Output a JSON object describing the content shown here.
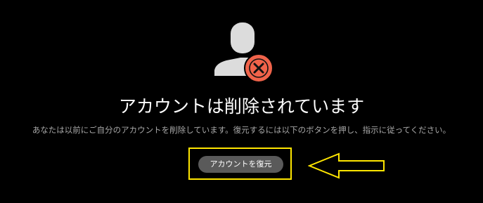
{
  "icons": {
    "avatar": "user-deleted-icon",
    "badge": "close-icon",
    "pointer": "arrow-left-icon"
  },
  "colors": {
    "background": "#000000",
    "avatar": "#dcdcdc",
    "badge": "#f0634a",
    "highlight": "#ffe600",
    "button": "#5a5a5a"
  },
  "main": {
    "title": "アカウントは削除されています",
    "description": "あなたは以前にご自分のアカウントを削除しています。復元するには以下のボタンを押し、指示に従ってください。",
    "restore_button_label": "アカウントを復元"
  }
}
